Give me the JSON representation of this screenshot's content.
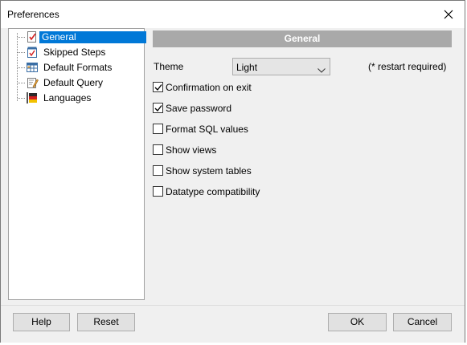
{
  "window": {
    "title": "Preferences"
  },
  "tree": {
    "items": [
      {
        "label": "General",
        "icon": "general-settings-icon",
        "selected": true
      },
      {
        "label": "Skipped Steps",
        "icon": "checklist-icon",
        "selected": false
      },
      {
        "label": "Default Formats",
        "icon": "table-format-icon",
        "selected": false
      },
      {
        "label": "Default Query",
        "icon": "query-edit-icon",
        "selected": false
      },
      {
        "label": "Languages",
        "icon": "flag-icon",
        "selected": false
      }
    ]
  },
  "panel": {
    "header": "General",
    "theme": {
      "label": "Theme",
      "value": "Light",
      "note": "(* restart required)"
    },
    "options": [
      {
        "label": "Confirmation on exit",
        "checked": true
      },
      {
        "label": "Save password",
        "checked": true
      },
      {
        "label": "Format SQL values",
        "checked": false
      },
      {
        "label": "Show views",
        "checked": false
      },
      {
        "label": "Show system tables",
        "checked": false
      },
      {
        "label": "Datatype compatibility",
        "checked": false
      }
    ]
  },
  "buttons": {
    "help": "Help",
    "reset": "Reset",
    "ok": "OK",
    "cancel": "Cancel"
  },
  "colors": {
    "selection": "#0078d7",
    "header_bg": "#a9a9a9",
    "dialog_bg": "#f0f0f0"
  }
}
